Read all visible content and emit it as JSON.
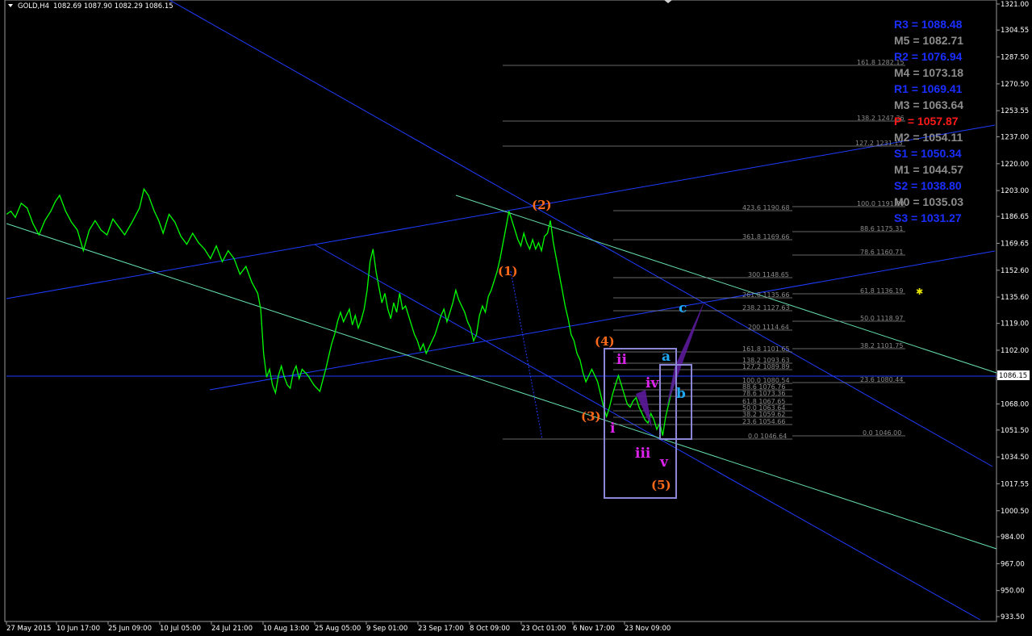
{
  "header": {
    "symbol_label": "GOLD,H4",
    "ohlc": "1082.69 1087.90 1082.29 1086.15"
  },
  "colors": {
    "background": "#000000",
    "price_line": "#00ff00",
    "channel": "#1f3cff",
    "trendline": "#66e0b0",
    "fib": "#8a8a8a",
    "wave_orange": "#ff6a1a",
    "wave_magenta": "#dd22ee",
    "wave_blue": "#1fa9f5",
    "box": "#8b86d6",
    "pivot_blue": "#1a2eff",
    "pivot_gray": "#8d8d8d",
    "pivot_red": "#ff1a1a",
    "purple_fill": "#5a1a9a"
  },
  "pivots": [
    {
      "label": "R3 = 1088.48",
      "color": "blue"
    },
    {
      "label": "M5 = 1082.71",
      "color": "gray"
    },
    {
      "label": "R2 = 1076.94",
      "color": "blue"
    },
    {
      "label": "M4 = 1073.18",
      "color": "gray"
    },
    {
      "label": "R1 = 1069.41",
      "color": "blue"
    },
    {
      "label": "M3 = 1063.64",
      "color": "gray"
    },
    {
      "label": "P  = 1057.87",
      "color": "red"
    },
    {
      "label": "M2 = 1054.11",
      "color": "gray"
    },
    {
      "label": "S1 = 1050.34",
      "color": "blue"
    },
    {
      "label": "M1 = 1044.57",
      "color": "gray"
    },
    {
      "label": "S2 = 1038.80",
      "color": "blue"
    },
    {
      "label": "M0 = 1035.03",
      "color": "gray"
    },
    {
      "label": "S3 = 1031.27",
      "color": "blue"
    }
  ],
  "chart_data": {
    "type": "line",
    "title": "GOLD,H4",
    "ylim": [
      930.0,
      1325.0
    ],
    "y_ticks": [
      "1321.00",
      "1304.55",
      "1287.50",
      "1270.50",
      "1253.55",
      "1237.00",
      "1220.00",
      "1203.00",
      "1186.65",
      "1169.65",
      "1152.60",
      "1135.60",
      "1119.00",
      "1102.00",
      "1085.00",
      "1068.00",
      "1051.50",
      "1034.50",
      "1017.55",
      "1000.50",
      "984.00",
      "967.00",
      "950.00",
      "933.50"
    ],
    "x_ticks": [
      "27 May 2015",
      "10 Jun 17:00",
      "25 Jun 09:00",
      "10 Jul 05:00",
      "24 Jul 21:00",
      "10 Aug 13:00",
      "25 Aug 05:00",
      "9 Sep 01:00",
      "23 Sep 17:00",
      "8 Oct 09:00",
      "23 Oct 01:00",
      "6 Nov 17:00",
      "23 Nov 09:00"
    ],
    "current_price": "1086.15",
    "series": [
      {
        "values": [
          [
            0,
            1188
          ],
          [
            3,
            1190
          ],
          [
            6,
            1186
          ],
          [
            10,
            1195
          ],
          [
            14,
            1192
          ],
          [
            18,
            1182
          ],
          [
            22,
            1175
          ],
          [
            26,
            1184
          ],
          [
            30,
            1190
          ],
          [
            33,
            1196
          ],
          [
            36,
            1200
          ],
          [
            40,
            1190
          ],
          [
            44,
            1183
          ],
          [
            48,
            1178
          ],
          [
            52,
            1165
          ],
          [
            56,
            1178
          ],
          [
            60,
            1184
          ],
          [
            64,
            1178
          ],
          [
            68,
            1175
          ],
          [
            72,
            1185
          ],
          [
            76,
            1180
          ],
          [
            80,
            1175
          ],
          [
            85,
            1183
          ],
          [
            90,
            1192
          ],
          [
            93,
            1204
          ],
          [
            96,
            1200
          ],
          [
            100,
            1190
          ],
          [
            103,
            1184
          ],
          [
            106,
            1176
          ],
          [
            110,
            1188
          ],
          [
            114,
            1183
          ],
          [
            118,
            1174
          ],
          [
            122,
            1169
          ],
          [
            126,
            1176
          ],
          [
            130,
            1170
          ],
          [
            134,
            1166
          ],
          [
            138,
            1160
          ],
          [
            142,
            1168
          ],
          [
            146,
            1158
          ],
          [
            150,
            1165
          ],
          [
            154,
            1160
          ],
          [
            158,
            1150
          ],
          [
            162,
            1155
          ],
          [
            166,
            1145
          ],
          [
            170,
            1138
          ],
          [
            172,
            1128
          ],
          [
            174,
            1100
          ],
          [
            176,
            1085
          ],
          [
            178,
            1090
          ],
          [
            180,
            1080
          ],
          [
            182,
            1075
          ],
          [
            184,
            1086
          ],
          [
            186,
            1092
          ],
          [
            188,
            1085
          ],
          [
            190,
            1080
          ],
          [
            192,
            1078
          ],
          [
            194,
            1088
          ],
          [
            196,
            1092
          ],
          [
            198,
            1084
          ],
          [
            200,
            1090
          ],
          [
            204,
            1086
          ],
          [
            208,
            1080
          ],
          [
            212,
            1076
          ],
          [
            214,
            1083
          ],
          [
            216,
            1090
          ],
          [
            218,
            1098
          ],
          [
            220,
            1106
          ],
          [
            222,
            1112
          ],
          [
            224,
            1120
          ],
          [
            226,
            1126
          ],
          [
            228,
            1120
          ],
          [
            232,
            1128
          ],
          [
            234,
            1118
          ],
          [
            236,
            1124
          ],
          [
            238,
            1116
          ],
          [
            240,
            1121
          ],
          [
            242,
            1128
          ],
          [
            244,
            1140
          ],
          [
            246,
            1158
          ],
          [
            248,
            1166
          ],
          [
            250,
            1152
          ],
          [
            252,
            1142
          ],
          [
            254,
            1132
          ],
          [
            256,
            1138
          ],
          [
            258,
            1128
          ],
          [
            260,
            1122
          ],
          [
            262,
            1132
          ],
          [
            264,
            1126
          ],
          [
            266,
            1138
          ],
          [
            268,
            1128
          ],
          [
            270,
            1130
          ],
          [
            272,
            1124
          ],
          [
            274,
            1118
          ],
          [
            276,
            1112
          ],
          [
            278,
            1108
          ],
          [
            280,
            1102
          ],
          [
            282,
            1106
          ],
          [
            284,
            1100
          ],
          [
            286,
            1104
          ],
          [
            288,
            1108
          ],
          [
            290,
            1112
          ],
          [
            292,
            1118
          ],
          [
            294,
            1124
          ],
          [
            296,
            1128
          ],
          [
            298,
            1120
          ],
          [
            300,
            1126
          ],
          [
            302,
            1132
          ],
          [
            304,
            1140
          ],
          [
            306,
            1134
          ],
          [
            308,
            1130
          ],
          [
            310,
            1126
          ],
          [
            312,
            1120
          ],
          [
            314,
            1116
          ],
          [
            316,
            1108
          ],
          [
            318,
            1112
          ],
          [
            320,
            1124
          ],
          [
            322,
            1130
          ],
          [
            324,
            1126
          ],
          [
            326,
            1136
          ],
          [
            328,
            1140
          ],
          [
            330,
            1146
          ],
          [
            332,
            1152
          ],
          [
            334,
            1160
          ],
          [
            336,
            1170
          ],
          [
            338,
            1180
          ],
          [
            340,
            1190
          ],
          [
            342,
            1184
          ],
          [
            344,
            1178
          ],
          [
            346,
            1172
          ],
          [
            348,
            1168
          ],
          [
            350,
            1176
          ],
          [
            352,
            1170
          ],
          [
            354,
            1166
          ],
          [
            356,
            1172
          ],
          [
            358,
            1166
          ],
          [
            360,
            1170
          ],
          [
            362,
            1165
          ],
          [
            364,
            1174
          ],
          [
            366,
            1176
          ],
          [
            368,
            1184
          ],
          [
            370,
            1170
          ],
          [
            372,
            1160
          ],
          [
            374,
            1150
          ],
          [
            376,
            1140
          ],
          [
            378,
            1130
          ],
          [
            380,
            1122
          ],
          [
            382,
            1112
          ],
          [
            384,
            1108
          ],
          [
            386,
            1100
          ],
          [
            388,
            1096
          ],
          [
            390,
            1088
          ],
          [
            392,
            1082
          ],
          [
            394,
            1086
          ],
          [
            396,
            1090
          ],
          [
            398,
            1086
          ],
          [
            400,
            1082
          ],
          [
            402,
            1074
          ],
          [
            404,
            1066
          ],
          [
            406,
            1060
          ],
          [
            408,
            1066
          ],
          [
            410,
            1074
          ],
          [
            412,
            1080
          ],
          [
            414,
            1086
          ],
          [
            416,
            1080
          ],
          [
            418,
            1074
          ],
          [
            420,
            1068
          ],
          [
            422,
            1066
          ],
          [
            424,
            1070
          ],
          [
            426,
            1072
          ],
          [
            428,
            1066
          ],
          [
            430,
            1062
          ],
          [
            432,
            1058
          ],
          [
            434,
            1056
          ],
          [
            436,
            1062
          ],
          [
            438,
            1058
          ],
          [
            440,
            1052
          ],
          [
            442,
            1056
          ],
          [
            444,
            1048
          ],
          [
            446,
            1060
          ],
          [
            448,
            1068
          ],
          [
            450,
            1076
          ],
          [
            452,
            1086
          ]
        ]
      }
    ]
  },
  "fib_left": [
    {
      "label": "161.8 1282.15"
    },
    {
      "label": "138.2 1247.36"
    },
    {
      "label": "127.2 1231.13"
    },
    {
      "label": "423.6 1190.68"
    },
    {
      "label": "361.8 1169.66"
    },
    {
      "label": "300 1148.65"
    },
    {
      "label": "261.8 1135.66"
    },
    {
      "label": "238.2 1127.63"
    },
    {
      "label": "200 1114.64"
    },
    {
      "label": "161.8 1101.65"
    },
    {
      "label": "138.2 1093.63"
    },
    {
      "label": "127.2 1089.89"
    },
    {
      "label": "100.0 1080.54"
    },
    {
      "label": "88.6 1076.76"
    },
    {
      "label": "78.6 1073.36"
    },
    {
      "label": "61.8 1067.65"
    },
    {
      "label": "50.0 1063.64"
    },
    {
      "label": "38.2 1059.62"
    },
    {
      "label": "23.6 1054.66"
    },
    {
      "label": "0.0 1046.64"
    }
  ],
  "fib_right": [
    {
      "label": "100.0 1191.00"
    },
    {
      "label": "88.6 1175.31"
    },
    {
      "label": "78.6 1160.71"
    },
    {
      "label": "61.8 1136.19"
    },
    {
      "label": "50.0 1118.97"
    },
    {
      "label": "38.2 1101.75"
    },
    {
      "label": "23.6 1080.44"
    },
    {
      "label": "0.0 1046.00"
    }
  ],
  "waves": {
    "orange": [
      "(1)",
      "(2)",
      "(3)",
      "(4)",
      "(5)"
    ],
    "magenta": [
      "i",
      "ii",
      "iii",
      "iv",
      "v"
    ],
    "blue": [
      "a",
      "b",
      "c"
    ]
  }
}
